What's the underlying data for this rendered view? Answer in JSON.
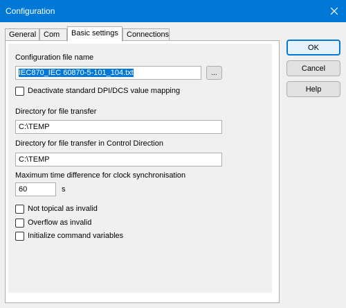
{
  "window": {
    "title": "Configuration"
  },
  "tabs": [
    {
      "label": "General"
    },
    {
      "label": "Com"
    },
    {
      "label": "Basic settings"
    },
    {
      "label": "Connections"
    }
  ],
  "active_tab": "Basic settings",
  "basic": {
    "config_file_label": "Configuration file name",
    "config_file_value": "IEC870_IEC 60870-5-101_104.txt",
    "browse_label": "...",
    "deactivate_label": "Deactivate standard DPI/DCS value mapping",
    "dir_transfer_label": "Directory for file transfer",
    "dir_transfer_value": "C:\\TEMP",
    "dir_control_label": "Directory for file transfer in Control Direction",
    "dir_control_value": "C:\\TEMP",
    "max_time_label": "Maximum time difference for clock synchronisation",
    "max_time_value": "60",
    "max_time_unit": "s",
    "not_topical_label": "Not topical as invalid",
    "overflow_label": "Overflow as invalid",
    "init_cmd_label": "Initialize command variables"
  },
  "buttons": {
    "ok": "OK",
    "cancel": "Cancel",
    "help": "Help"
  },
  "colors": {
    "accent": "#0078d7",
    "titlebar_text": "#ffffff"
  }
}
